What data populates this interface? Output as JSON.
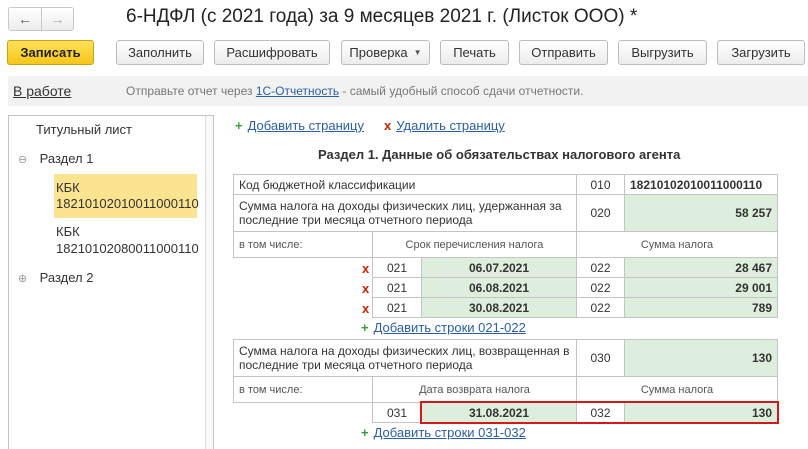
{
  "window": {
    "title": "6-НДФЛ (с 2021 года) за 9 месяцев 2021 г. (Листок ООО) *",
    "nav_back": "←",
    "nav_forward": "→"
  },
  "toolbar": {
    "save": "Записать",
    "fill": "Заполнить",
    "decode": "Расшифровать",
    "check": "Проверка",
    "print": "Печать",
    "send": "Отправить",
    "export": "Выгрузить",
    "import": "Загрузить"
  },
  "status": {
    "state": "В работе",
    "msg_before": "Отправьте отчет через ",
    "msg_link": "1С-Отчетность",
    "msg_after": " - самый удобный способ сдачи отчетности."
  },
  "tree": {
    "title_sheet": "Титульный лист",
    "section1": "Раздел 1",
    "kbk1_label": "КБК",
    "kbk1_code": "18210102010011000110",
    "kbk2_label": "КБК",
    "kbk2_code": "18210102080011000110",
    "section2": "Раздел 2",
    "collapse_glyph": "⊖",
    "expand_glyph": "⊕"
  },
  "form": {
    "add_page": "Добавить страницу",
    "delete_page": "Удалить страницу",
    "section_title": "Раздел 1. Данные об обязательствах налогового агента",
    "plus_glyph": "+",
    "cross_glyph": "x",
    "kbk_label": "Код бюджетной классификации",
    "kbk_code": "010",
    "kbk_value": "18210102010011000110",
    "withheld_label": "Сумма налога на доходы физических лиц, удержанная за последние три месяца отчетного периода",
    "withheld_code": "020",
    "withheld_value": "58 257",
    "including": "в том числе:",
    "transfer_date_header": "Срок перечисления налога",
    "tax_sum_header": "Сумма налога",
    "rows_021": [
      {
        "code_a": "021",
        "date": "06.07.2021",
        "code_b": "022",
        "sum": "28 467"
      },
      {
        "code_a": "021",
        "date": "06.08.2021",
        "code_b": "022",
        "sum": "29 001"
      },
      {
        "code_a": "021",
        "date": "30.08.2021",
        "code_b": "022",
        "sum": "789"
      }
    ],
    "add_rows_021": "Добавить строки 021-022",
    "returned_label": "Сумма налога на доходы физических лиц, возвращенная в последние три месяца отчетного периода",
    "returned_code": "030",
    "returned_value": "130",
    "including2": "в том числе:",
    "return_date_header": "Дата возврата налога",
    "tax_sum_header2": "Сумма налога",
    "row_031": {
      "code_a": "031",
      "date": "31.08.2021",
      "code_b": "032",
      "sum": "130"
    },
    "add_rows_031": "Добавить строки 031-032"
  },
  "colors": {
    "accent_yellow": "#f7c518",
    "selection": "#fbe38f",
    "green_cell": "#ddeedd",
    "link": "#2a5ea8",
    "highlight_red": "#d21a1a"
  }
}
